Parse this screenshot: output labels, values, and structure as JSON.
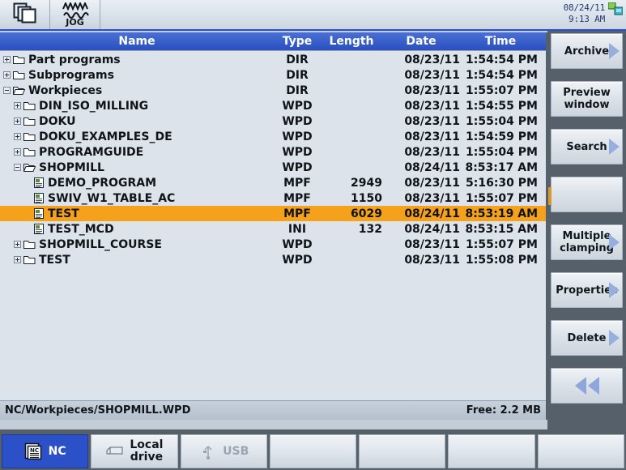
{
  "topbar": {
    "channel_icon": "windows-stack-icon",
    "mode_icon": "jog-wave-icon",
    "mode_label": "JOG",
    "date": "08/24/11",
    "time": "9:13 AM",
    "network_icon": "network-status-icon"
  },
  "table": {
    "headers": {
      "name": "Name",
      "type": "Type",
      "length": "Length",
      "date": "Date",
      "time": "Time"
    },
    "rows": [
      {
        "name": "Part programs",
        "type": "DIR",
        "length": "",
        "date": "08/23/11",
        "time": "1:54:54 PM",
        "level": 0,
        "kind": "folder",
        "expand": "plus",
        "selected": false
      },
      {
        "name": "Subprograms",
        "type": "DIR",
        "length": "",
        "date": "08/23/11",
        "time": "1:54:54 PM",
        "level": 0,
        "kind": "folder",
        "expand": "plus",
        "selected": false
      },
      {
        "name": "Workpieces",
        "type": "DIR",
        "length": "",
        "date": "08/23/11",
        "time": "1:55:07 PM",
        "level": 0,
        "kind": "folderopen",
        "expand": "minus",
        "selected": false
      },
      {
        "name": "DIN_ISO_MILLING",
        "type": "WPD",
        "length": "",
        "date": "08/23/11",
        "time": "1:54:55 PM",
        "level": 1,
        "kind": "folder",
        "expand": "plus",
        "selected": false
      },
      {
        "name": "DOKU",
        "type": "WPD",
        "length": "",
        "date": "08/23/11",
        "time": "1:55:04 PM",
        "level": 1,
        "kind": "folder",
        "expand": "plus",
        "selected": false
      },
      {
        "name": "DOKU_EXAMPLES_DE",
        "type": "WPD",
        "length": "",
        "date": "08/23/11",
        "time": "1:54:59 PM",
        "level": 1,
        "kind": "folder",
        "expand": "plus",
        "selected": false
      },
      {
        "name": "PROGRAMGUIDE",
        "type": "WPD",
        "length": "",
        "date": "08/23/11",
        "time": "1:55:04 PM",
        "level": 1,
        "kind": "folder",
        "expand": "plus",
        "selected": false
      },
      {
        "name": "SHOPMILL",
        "type": "WPD",
        "length": "",
        "date": "08/24/11",
        "time": "8:53:17 AM",
        "level": 1,
        "kind": "folderopen",
        "expand": "minus",
        "selected": false
      },
      {
        "name": "DEMO_PROGRAM",
        "type": "MPF",
        "length": "2949",
        "date": "08/23/11",
        "time": "5:16:30 PM",
        "level": 2,
        "kind": "file",
        "expand": "none",
        "selected": false
      },
      {
        "name": "SWIV_W1_TABLE_AC",
        "type": "MPF",
        "length": "1150",
        "date": "08/23/11",
        "time": "1:55:07 PM",
        "level": 2,
        "kind": "file",
        "expand": "none",
        "selected": false
      },
      {
        "name": "TEST",
        "type": "MPF",
        "length": "6029",
        "date": "08/24/11",
        "time": "8:53:19 AM",
        "level": 2,
        "kind": "file",
        "expand": "none",
        "selected": true
      },
      {
        "name": "TEST_MCD",
        "type": "INI",
        "length": "132",
        "date": "08/24/11",
        "time": "8:53:15 AM",
        "level": 2,
        "kind": "file",
        "expand": "none",
        "selected": false
      },
      {
        "name": "SHOPMILL_COURSE",
        "type": "WPD",
        "length": "",
        "date": "08/23/11",
        "time": "1:55:07 PM",
        "level": 1,
        "kind": "folder",
        "expand": "plus",
        "selected": false
      },
      {
        "name": "TEST",
        "type": "WPD",
        "length": "",
        "date": "08/23/11",
        "time": "1:55:08 PM",
        "level": 1,
        "kind": "folder",
        "expand": "plus",
        "selected": false
      }
    ]
  },
  "status": {
    "path": "NC/Workpieces/SHOPMILL.WPD",
    "free": "Free: 2.2 MB"
  },
  "softkeys": [
    {
      "label": "Archive",
      "arrow": "single",
      "blank": false
    },
    {
      "label": "Preview\nwindow",
      "arrow": "none",
      "blank": false
    },
    {
      "label": "Search",
      "arrow": "single",
      "blank": false
    },
    {
      "label": "",
      "arrow": "none",
      "blank": true
    },
    {
      "label": "Multiple\nclamping",
      "arrow": "single",
      "blank": false
    },
    {
      "label": "Properties",
      "arrow": "single",
      "blank": false
    },
    {
      "label": "Delete",
      "arrow": "single",
      "blank": false
    },
    {
      "label": "",
      "arrow": "double",
      "blank": false
    }
  ],
  "bottom_tabs": [
    {
      "label": "NC",
      "icon": "nc-document-icon",
      "active": true,
      "dim": false
    },
    {
      "label": "Local\ndrive",
      "icon": "drive-icon",
      "active": false,
      "dim": false
    },
    {
      "label": "USB",
      "icon": "usb-icon",
      "active": false,
      "dim": true
    },
    {
      "label": "",
      "icon": "",
      "active": false,
      "dim": false
    },
    {
      "label": "",
      "icon": "",
      "active": false,
      "dim": false
    },
    {
      "label": "",
      "icon": "",
      "active": false,
      "dim": false
    },
    {
      "label": "",
      "icon": "",
      "active": false,
      "dim": false
    }
  ],
  "colors": {
    "header_blue": "#2a50c0",
    "selection_orange": "#f5a11c",
    "panel_bg": "#dce3eb",
    "softkey_bg": "#55606b",
    "accent_arrow": "#98aedd"
  }
}
